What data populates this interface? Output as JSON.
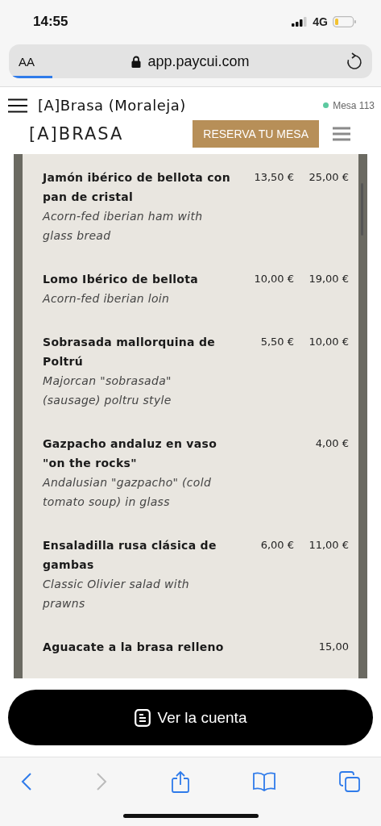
{
  "status_bar": {
    "time": "14:55",
    "network": "4G"
  },
  "url_bar": {
    "text_size": "AA",
    "url": "app.paycui.com",
    "loading": {
      "level": 0.12
    }
  },
  "header": {
    "title": "[A]Brasa (Moraleja)",
    "table": {
      "label": "Mesa 113",
      "color": "#5cc9a0"
    }
  },
  "site_nav": {
    "logo": "[A]BRASA",
    "button": "RESERVA TU MESA"
  },
  "menu_items": [
    {
      "name": "Jamón ibérico de bellota con pan de cristal",
      "description": "Acorn-fed iberian ham with glass bread",
      "price_1": "13,50 €",
      "price_2": "25,00 €"
    },
    {
      "name": "Lomo Ibérico de bellota",
      "description": "Acorn-fed iberian loin",
      "price_1": "10,00 €",
      "price_2": "19,00 €"
    },
    {
      "name": "Sobrasada mallorquina de Poltrú",
      "description": "Majorcan \"sobrasada\" (sausage) poltru style",
      "price_1": "5,50 €",
      "price_2": "10,00 €"
    },
    {
      "name": "Gazpacho andaluz en vaso \"on the rocks\"",
      "description": "Andalusian \"gazpacho\" (cold tomato soup) in glass",
      "price_2": "4,00 €"
    },
    {
      "name": "Ensaladilla rusa clásica de gambas",
      "description": "Classic Olivier salad with prawns",
      "price_1": "6,00 €",
      "price_2": "11,00 €"
    },
    {
      "name": "Aguacate a la brasa relleno",
      "price_2": "15,00"
    }
  ],
  "bill_button": "Ver la cuenta",
  "toolbar": [
    {
      "kind": "back",
      "disabled": false
    },
    {
      "kind": "forward",
      "disabled": true
    },
    {
      "kind": "share",
      "disabled": false
    },
    {
      "kind": "bookmarks",
      "disabled": false
    },
    {
      "kind": "tabs",
      "disabled": false
    }
  ]
}
